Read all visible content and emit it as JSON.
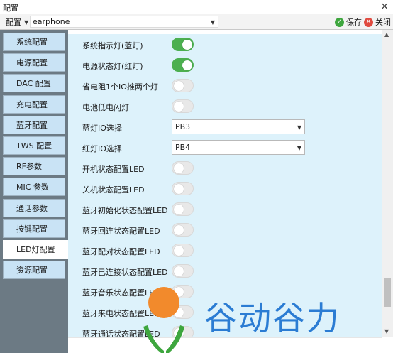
{
  "window": {
    "title": "配置",
    "close_glyph": "×"
  },
  "toolbar": {
    "menu_label": "配置",
    "device_value": "earphone",
    "save_label": "保存",
    "close_label": "关闭"
  },
  "sidebar": {
    "items": [
      {
        "label": "系统配置",
        "active": false
      },
      {
        "label": "电源配置",
        "active": false
      },
      {
        "label": "DAC 配置",
        "active": false
      },
      {
        "label": "充电配置",
        "active": false
      },
      {
        "label": "蓝牙配置",
        "active": false
      },
      {
        "label": "TWS 配置",
        "active": false
      },
      {
        "label": "RF参数",
        "active": false
      },
      {
        "label": "MIC 参数",
        "active": false
      },
      {
        "label": "通话参数",
        "active": false
      },
      {
        "label": "按键配置",
        "active": false
      },
      {
        "label": "LED灯配置",
        "active": true
      },
      {
        "label": "资源配置",
        "active": false
      }
    ]
  },
  "settings": [
    {
      "label": "系统指示灯(蓝灯)",
      "type": "toggle",
      "value": true
    },
    {
      "label": "电源状态灯(红灯)",
      "type": "toggle",
      "value": true
    },
    {
      "label": "省电阻1个IO推两个灯",
      "type": "toggle",
      "value": false
    },
    {
      "label": "电池低电闪灯",
      "type": "toggle",
      "value": false
    },
    {
      "label": "蓝灯IO选择",
      "type": "select",
      "value": "PB3"
    },
    {
      "label": "红灯IO选择",
      "type": "select",
      "value": "PB4"
    },
    {
      "label": "开机状态配置LED",
      "type": "toggle",
      "value": false
    },
    {
      "label": "关机状态配置LED",
      "type": "toggle",
      "value": false
    },
    {
      "label": "蓝牙初始化状态配置LED",
      "type": "toggle",
      "value": false
    },
    {
      "label": "蓝牙回连状态配置LED",
      "type": "toggle",
      "value": false
    },
    {
      "label": "蓝牙配对状态配置LED",
      "type": "toggle",
      "value": false
    },
    {
      "label": "蓝牙已连接状态配置LED",
      "type": "toggle",
      "value": false
    },
    {
      "label": "蓝牙音乐状态配置LED",
      "type": "toggle",
      "value": false
    },
    {
      "label": "蓝牙来电状态配置LED",
      "type": "toggle",
      "value": false
    },
    {
      "label": "蓝牙通话状态配置LED",
      "type": "toggle",
      "value": false
    }
  ],
  "watermark": {
    "text": "谷动谷力"
  },
  "colors": {
    "sidebar_bg": "#6c7a84",
    "sidebar_item": "#c9e3f5",
    "content_bg": "#ddf2fb",
    "toggle_on": "#4caf50"
  }
}
